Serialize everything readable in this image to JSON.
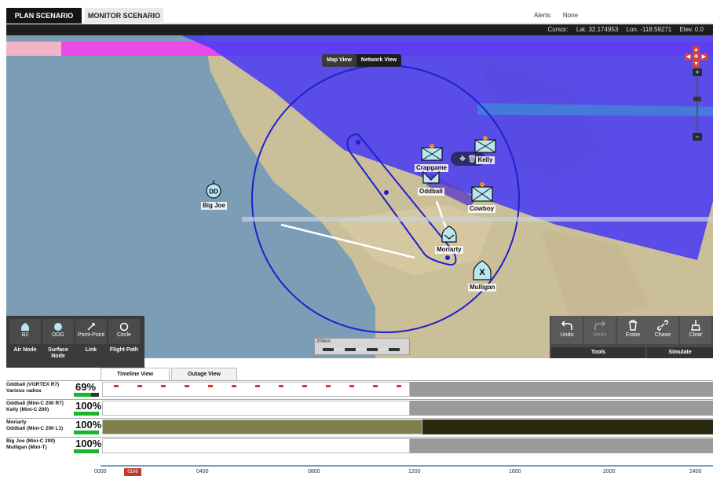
{
  "header": {
    "tabs": [
      {
        "label": "PLAN SCENARIO",
        "active": true
      },
      {
        "label": "MONITOR SCENARIO",
        "active": false
      }
    ],
    "alerts_label": "Alerts:",
    "alerts_value": "None"
  },
  "status": {
    "cursor_label": "Cursor:",
    "lat": "Lat. 32.174953",
    "lon": "Lon. -118.59271",
    "elev": "Elev. 0.0"
  },
  "map": {
    "view_toggle": {
      "map_view": "Map View",
      "network_view": "Network View",
      "selected": "Map View"
    },
    "scale_label": "200km",
    "nodes": [
      {
        "name": "Big Joe",
        "code": "DD"
      },
      {
        "name": "Crapgame"
      },
      {
        "name": "Kelly"
      },
      {
        "name": "Oddball"
      },
      {
        "name": "Cowboy"
      },
      {
        "name": "Moriarty"
      },
      {
        "name": "Mulligan",
        "code": "X"
      }
    ]
  },
  "palette": {
    "items": [
      {
        "label": "B2",
        "group": "Air Node"
      },
      {
        "label": "DDG",
        "group": "Surface Node"
      },
      {
        "label": "Point-Point",
        "group": "Link"
      },
      {
        "label": "Circle",
        "group": "Flight Path"
      }
    ],
    "groups": [
      "Air Node",
      "Surface Node",
      "Link",
      "Flight Path"
    ]
  },
  "tools": {
    "buttons": [
      {
        "label": "Undo",
        "enabled": true
      },
      {
        "label": "Redo",
        "enabled": false
      },
      {
        "label": "Erase",
        "enabled": true
      },
      {
        "label": "Chase",
        "enabled": true
      },
      {
        "label": "Clear",
        "enabled": true
      }
    ],
    "group_tools": "Tools",
    "group_simulate": "Simulate"
  },
  "timeline": {
    "tabs": [
      {
        "label": "Timeline View",
        "active": true
      },
      {
        "label": "Outage View",
        "active": false
      }
    ],
    "rows": [
      {
        "line1": "Oddball (VORTEX R7)",
        "line2": "Various radios",
        "pct": "69%",
        "value": 0.69
      },
      {
        "line1": "Oddball (Mini-C 200 R7)",
        "line2": "Kelly (Mini-C 200)",
        "pct": "100%",
        "value": 1.0
      },
      {
        "line1": "Moriarty",
        "line2": "Oddball (Mini-C 200 L1)",
        "pct": "100%",
        "value": 1.0
      },
      {
        "line1": "Big Joe (Mini-C 200)",
        "line2": "Mulligan (Mini-T)",
        "pct": "100%",
        "value": 1.0
      }
    ],
    "axis_ticks": [
      "0000",
      "0400",
      "0800",
      "1200",
      "1600",
      "2000",
      "2400"
    ],
    "cursor_time": "0106"
  },
  "colors": {
    "coverage_band": "#4a3cf0",
    "magenta_band": "#e84be8",
    "circle_stroke": "#1f1fcf",
    "pct_green": "#19b52a",
    "tab_active_bg": "#151515"
  }
}
